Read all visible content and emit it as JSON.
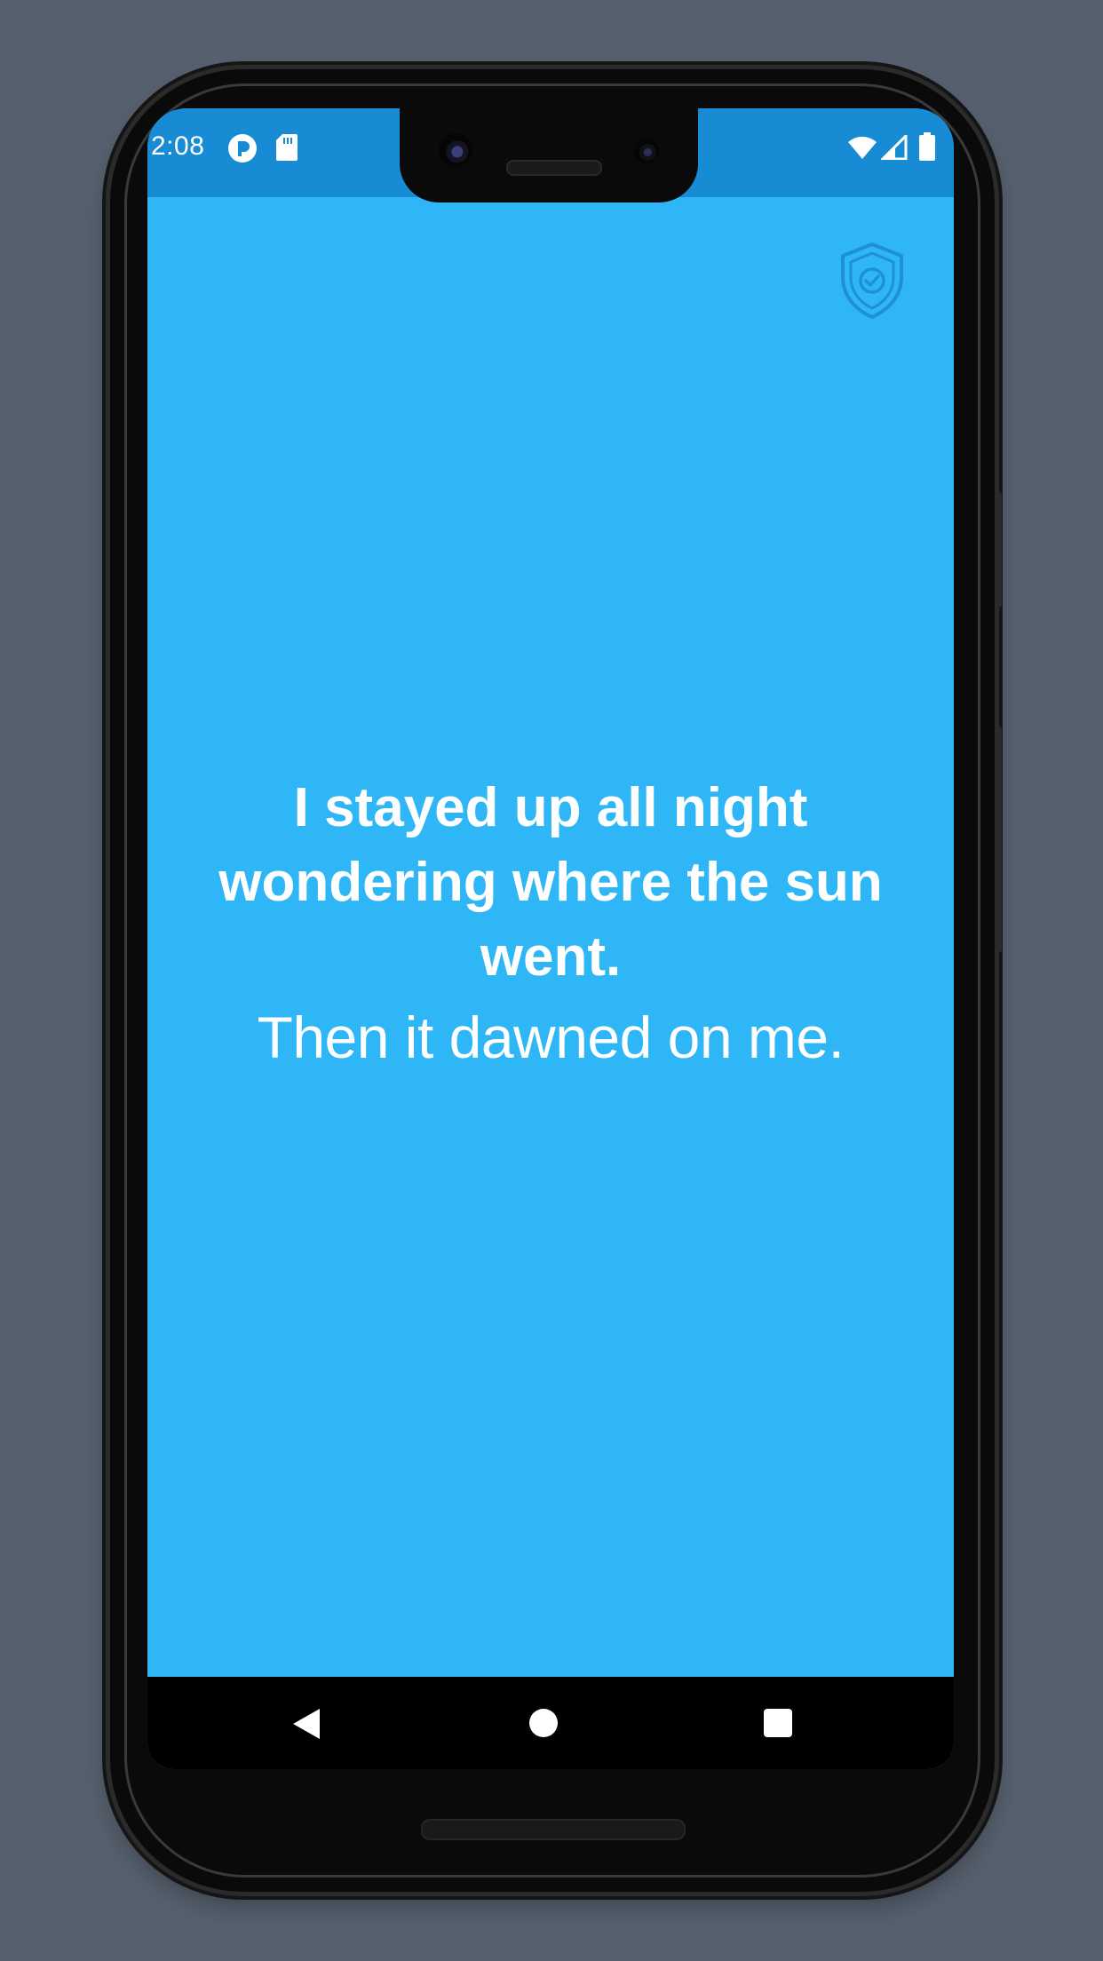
{
  "status_bar": {
    "time": "2:08",
    "icons": [
      "app-notification-icon",
      "sd-card-icon",
      "wifi-icon",
      "cell-signal-icon",
      "battery-icon"
    ],
    "color": "#178bd3"
  },
  "header": {
    "icons": [
      "shield-check-icon"
    ]
  },
  "joke": {
    "setup": "I stayed up all night wondering where the sun went.",
    "punchline": "Then it dawned on me."
  },
  "navigation": {
    "buttons": [
      "back-icon",
      "home-icon",
      "recents-icon"
    ]
  },
  "colors": {
    "background": "#2eb6f6",
    "status_bar": "#178bd3",
    "text": "#ffffff",
    "shield": "#1e90d6"
  }
}
